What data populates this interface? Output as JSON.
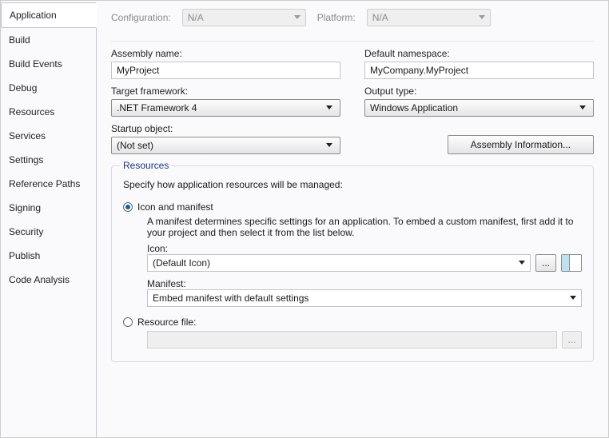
{
  "sidebar": {
    "tabs": [
      "Application",
      "Build",
      "Build Events",
      "Debug",
      "Resources",
      "Services",
      "Settings",
      "Reference Paths",
      "Signing",
      "Security",
      "Publish",
      "Code Analysis"
    ]
  },
  "top": {
    "config_label": "Configuration:",
    "config_value": "N/A",
    "platform_label": "Platform:",
    "platform_value": "N/A"
  },
  "fields": {
    "assembly_name_label": "Assembly name:",
    "assembly_name_value": "MyProject",
    "default_ns_label": "Default namespace:",
    "default_ns_value": "MyCompany.MyProject",
    "target_fw_label": "Target framework:",
    "target_fw_value": ".NET Framework 4",
    "output_type_label": "Output type:",
    "output_type_value": "Windows Application",
    "startup_label": "Startup object:",
    "startup_value": "(Not set)",
    "asm_info_btn": "Assembly Information..."
  },
  "resources": {
    "group_title": "Resources",
    "description": "Specify how application resources will be managed:",
    "icon_manifest_label": "Icon and manifest",
    "icon_manifest_desc": "A manifest determines specific settings for an application. To embed a custom manifest, first add it to your project and then select it from the list below.",
    "icon_label": "Icon:",
    "icon_value": "(Default Icon)",
    "browse_label": "...",
    "manifest_label": "Manifest:",
    "manifest_value": "Embed manifest with default settings",
    "resource_file_label": "Resource file:",
    "resource_file_browse": "..."
  }
}
